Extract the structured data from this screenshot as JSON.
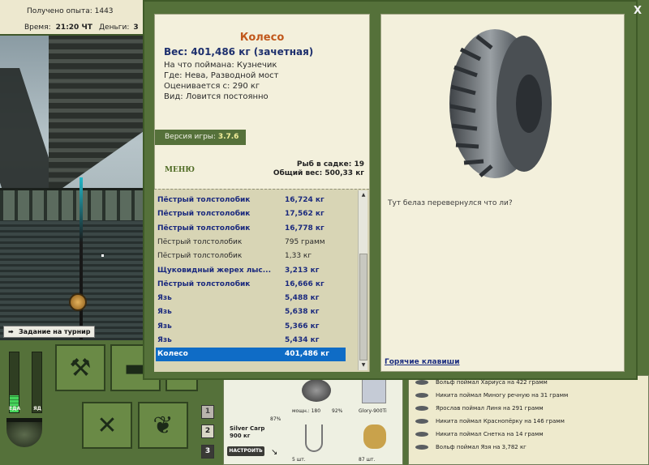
{
  "status": {
    "xp_label": "Получено опыта:",
    "xp_value": "1443",
    "time_label": "Время:",
    "time_value": "21:20 ЧТ",
    "money_label": "Деньги:",
    "money_value": "3"
  },
  "scene": {
    "task_label": "Задание на турнир"
  },
  "meters": {
    "food_label": "ЕДА",
    "poison_label": "ЯД",
    "food_level": 0.28,
    "poison_level": 0.0
  },
  "tool_buttons": [
    "tackle",
    "tackle-box",
    "map",
    "cook",
    "fish-guide"
  ],
  "page_buttons": [
    "1",
    "2",
    "3"
  ],
  "gear": {
    "rod_name": "Silver Carp",
    "rod_weight": "900 кг",
    "setup_label": "НАСТРОИТЬ",
    "rod_percent": "87%",
    "reel_stat": "мощн.: 180",
    "reel_percent": "92%",
    "line_name": "Glory-900Ti",
    "hooks_count": "5 шт.",
    "bait_count": "87 шт."
  },
  "log": [
    "Вольф поймал Хариуса на 422 грамм",
    "Никита поймал Миногу речную на 31 грамм",
    "Ярослав поймал Линя на 291 грамм",
    "Никита поймал Краснопёрку на 146 грамм",
    "Никита поймал Снетка на 14 грамм",
    "Вольф поймал Язя на 3,782 кг"
  ],
  "popup": {
    "close_label": "X",
    "catch_name": "Колесо",
    "catch_weight": "Вес: 401,486 кг (зачетная)",
    "bait_line": "На что поймана: Кузнечик",
    "place_line": "Где: Нева, Разводной мост",
    "rated_line": "Оценивается с: 290 кг",
    "kind_line": "Вид: Ловится постоянно",
    "version_label": "Версия игры:",
    "version_value": "3.7.6",
    "menu_label": "МЕНЮ",
    "cage_count": "Рыб в садке: 19",
    "total_weight": "Общий вес: 500,33 кг",
    "description": "Тут белаз перевернулся что ли?",
    "hotkeys_label": "Горячие клавиши",
    "fish": [
      {
        "name": "Пёстрый толстолобик",
        "weight": "16,724 кг",
        "style": "trophy"
      },
      {
        "name": "Пёстрый толстолобик",
        "weight": "17,562 кг",
        "style": "trophy"
      },
      {
        "name": "Пёстрый толстолобик",
        "weight": "16,778 кг",
        "style": "trophy"
      },
      {
        "name": "Пёстрый толстолобик",
        "weight": "795 грамм",
        "style": "plain"
      },
      {
        "name": "Пёстрый толстолобик",
        "weight": "1,33 кг",
        "style": "plain"
      },
      {
        "name": "Щуковидный жерех лыс...",
        "weight": "3,213 кг",
        "style": "trophy"
      },
      {
        "name": "Пёстрый толстолобик",
        "weight": "16,666 кг",
        "style": "trophy"
      },
      {
        "name": "Язь",
        "weight": "5,488 кг",
        "style": "trophy"
      },
      {
        "name": "Язь",
        "weight": "5,638 кг",
        "style": "trophy"
      },
      {
        "name": "Язь",
        "weight": "5,366 кг",
        "style": "trophy"
      },
      {
        "name": "Язь",
        "weight": "5,434 кг",
        "style": "trophy"
      },
      {
        "name": "Колесо",
        "weight": "401,486 кг",
        "style": "selected"
      }
    ]
  }
}
